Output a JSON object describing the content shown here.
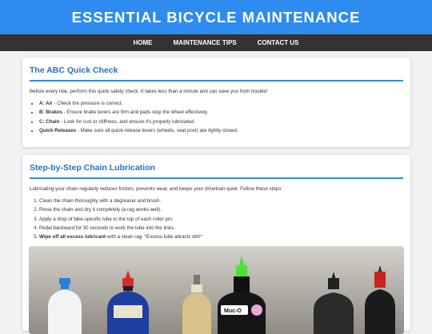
{
  "header": {
    "title": "ESSENTIAL BICYCLE MAINTENANCE"
  },
  "nav": {
    "items": [
      "HOME",
      "MAINTENANCE TIPS",
      "CONTACT US"
    ]
  },
  "abc": {
    "title": "The ABC Quick Check",
    "intro": "Before every ride, perform this quick safety check. It takes less than a minute and can save you from trouble!",
    "items": [
      {
        "label": "A: Air",
        "text": " - Check tire pressure is correct."
      },
      {
        "label": "B: Brakes",
        "text": " - Ensure brake levers are firm and pads stop the wheel effectively."
      },
      {
        "label": "C: Chain",
        "text": " - Look for rust or stiffness, and ensure it's properly lubricated."
      },
      {
        "label": "Quick-Releases",
        "text": " - Make sure all quick-release levers (wheels, seat post) are tightly closed."
      }
    ]
  },
  "chain": {
    "title": "Step-by-Step Chain Lubrication",
    "intro": "Lubricating your chain regularly reduces friction, prevents wear, and keeps your drivetrain quiet. Follow these steps:",
    "steps": [
      "Clean the chain thoroughly with a degreaser and brush.",
      "Rinse the chain and dry it completely (a rag works well).",
      "Apply a drop of bike-specific lube to the top of each roller pin.",
      "Pedal backward for 30 seconds to work the lube into the links."
    ],
    "last_step_bold": "Wipe off all excess lubricant",
    "last_step_text": " with a clean rag. *Excess lube attracts dirt!*",
    "photo_bottle_label": "Muc-O"
  }
}
